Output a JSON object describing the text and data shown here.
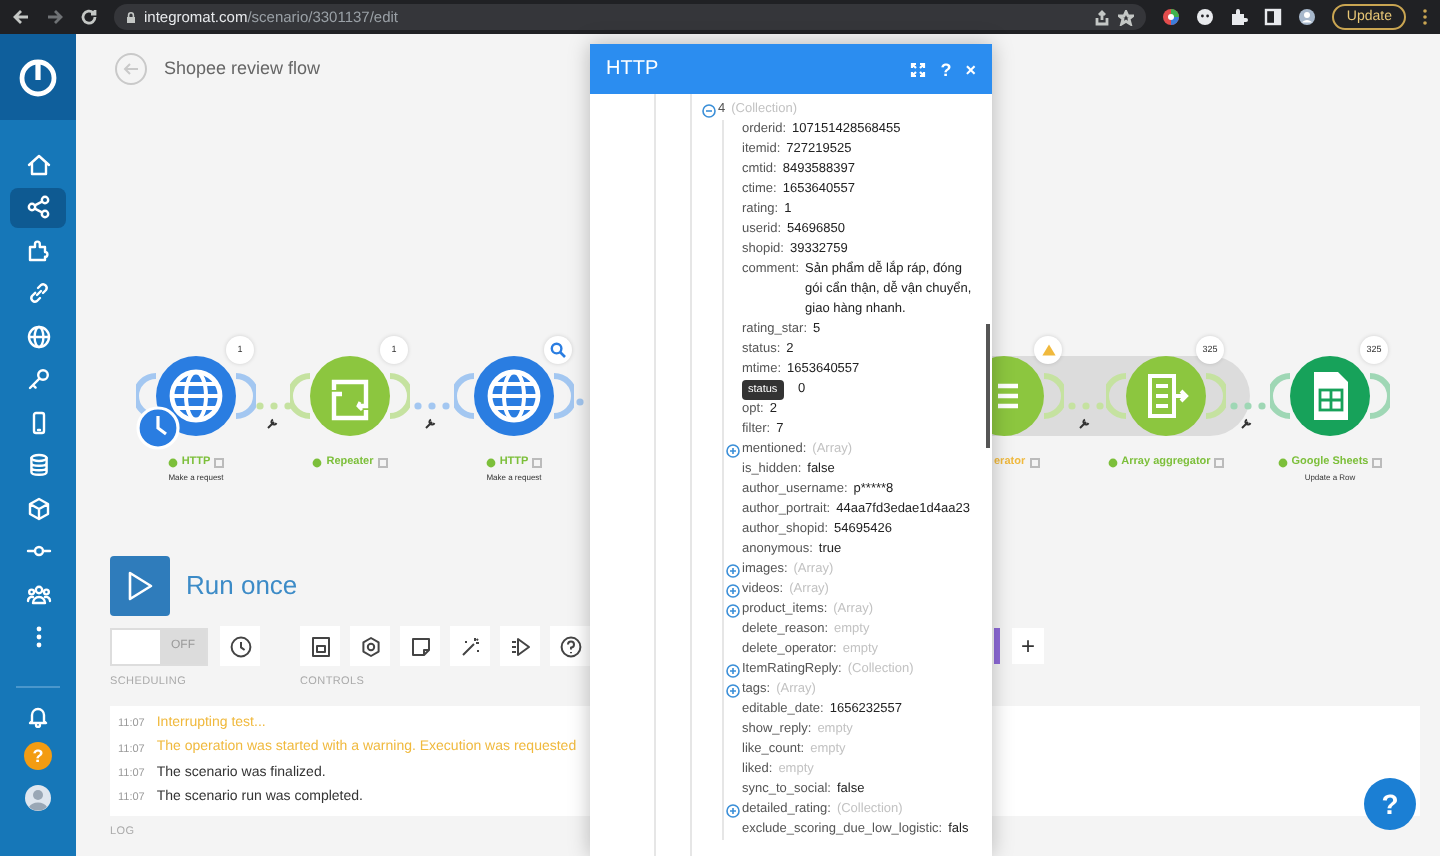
{
  "browser": {
    "url_host": "integromat.com",
    "url_path": "/scenario/3301137/edit",
    "update_label": "Update"
  },
  "sidebar": {
    "items": [
      {
        "selected": false
      },
      {
        "selected": true
      },
      {
        "selected": false
      },
      {
        "selected": false
      },
      {
        "selected": false
      },
      {
        "selected": false
      },
      {
        "selected": false
      },
      {
        "selected": false
      },
      {
        "selected": false
      },
      {
        "selected": false
      },
      {
        "selected": false
      },
      {
        "selected": false
      }
    ],
    "help_label": "?"
  },
  "scenario": {
    "title": "Shopee review flow"
  },
  "modules": [
    {
      "name": "HTTP",
      "subtitle": "Make a request",
      "count": "1",
      "kind": "http",
      "warning": false,
      "scheduled": true,
      "selected": false
    },
    {
      "name": "Repeater",
      "count": "1",
      "kind": "repeater",
      "warning": false,
      "scheduled": false,
      "selected": false
    },
    {
      "name": "HTTP",
      "subtitle": "Make a request",
      "kind": "http",
      "warning": false,
      "scheduled": false,
      "selected": true
    },
    {
      "name": "erator",
      "kind": "iterator",
      "warning": true,
      "scheduled": false,
      "selected": false
    },
    {
      "name": "Array aggregator",
      "count": "325",
      "kind": "aggregator",
      "warning": false,
      "scheduled": false,
      "selected": false
    },
    {
      "name": "Google Sheets",
      "subtitle": "Update a Row",
      "count": "325",
      "kind": "sheets",
      "warning": false,
      "scheduled": false,
      "selected": false
    }
  ],
  "run": {
    "label": "Run once"
  },
  "scheduling": {
    "label": "SCHEDULING",
    "toggle_label": "OFF",
    "on": false
  },
  "controls": {
    "label": "CONTROLS",
    "add_label": "+"
  },
  "log": {
    "label": "LOG",
    "entries": [
      {
        "time": "11:07",
        "text": "Interrupting test...",
        "warning": true
      },
      {
        "time": "11:07",
        "text": "The operation was started with a warning. Execution was requested",
        "warning": true
      },
      {
        "time": "11:07",
        "text": "The scenario was finalized.",
        "warning": false
      },
      {
        "time": "11:07",
        "text": "The scenario run was completed.",
        "warning": false
      }
    ]
  },
  "dialog": {
    "title": "HTTP",
    "help_label": "?",
    "close_label": "×",
    "tree": {
      "key": "4",
      "value": "(Collection)",
      "kind": "hint",
      "expanded": true,
      "children": [
        {
          "key": "orderid:",
          "value": "107151428568455",
          "kind": "value"
        },
        {
          "key": "itemid:",
          "value": "727219525",
          "kind": "value"
        },
        {
          "key": "cmtid:",
          "value": "8493588397",
          "kind": "value"
        },
        {
          "key": "ctime:",
          "value": "1653640557",
          "kind": "value"
        },
        {
          "key": "rating:",
          "value": "1",
          "kind": "value"
        },
        {
          "key": "userid:",
          "value": "54696850",
          "kind": "value"
        },
        {
          "key": "shopid:",
          "value": "39332759",
          "kind": "value"
        },
        {
          "key": "comment:",
          "value": "Sản phẩm dễ lắp ráp, đóng gói cẩn thận, dễ vận chuyển, giao hàng nhanh.",
          "kind": "value"
        },
        {
          "key": "rating_star:",
          "value": "5",
          "kind": "value"
        },
        {
          "key": "status:",
          "value": "2",
          "kind": "value"
        },
        {
          "key": "mtime:",
          "value": "1653640557",
          "kind": "value"
        },
        {
          "value": "0",
          "kind": "value",
          "tooltip": "status"
        },
        {
          "key": "opt:",
          "value": "2",
          "kind": "value"
        },
        {
          "key": "filter:",
          "value": "7",
          "kind": "value"
        },
        {
          "key": "mentioned:",
          "value": "(Array)",
          "kind": "hint",
          "expanded": false
        },
        {
          "key": "is_hidden:",
          "value": "false",
          "kind": "value"
        },
        {
          "key": "author_username:",
          "value": "p*****8",
          "kind": "value"
        },
        {
          "key": "author_portrait:",
          "value": "44aa7fd3edae1d4aa23",
          "kind": "value"
        },
        {
          "key": "author_shopid:",
          "value": "54695426",
          "kind": "value"
        },
        {
          "key": "anonymous:",
          "value": "true",
          "kind": "value"
        },
        {
          "key": "images:",
          "value": "(Array)",
          "kind": "hint",
          "expanded": false
        },
        {
          "key": "videos:",
          "value": "(Array)",
          "kind": "hint",
          "expanded": false
        },
        {
          "key": "product_items:",
          "value": "(Array)",
          "kind": "hint",
          "expanded": false
        },
        {
          "key": "delete_reason:",
          "value": "empty",
          "kind": "hint"
        },
        {
          "key": "delete_operator:",
          "value": "empty",
          "kind": "hint"
        },
        {
          "key": "ItemRatingReply:",
          "value": "(Collection)",
          "kind": "hint",
          "expanded": false
        },
        {
          "key": "tags:",
          "value": "(Array)",
          "kind": "hint",
          "expanded": false
        },
        {
          "key": "editable_date:",
          "value": "1656232557",
          "kind": "value"
        },
        {
          "key": "show_reply:",
          "value": "empty",
          "kind": "hint"
        },
        {
          "key": "like_count:",
          "value": "empty",
          "kind": "hint"
        },
        {
          "key": "liked:",
          "value": "empty",
          "kind": "hint"
        },
        {
          "key": "sync_to_social:",
          "value": "false",
          "kind": "value"
        },
        {
          "key": "detailed_rating:",
          "value": "(Collection)",
          "kind": "hint",
          "expanded": false
        },
        {
          "key": "exclude_scoring_due_low_logistic:",
          "value": "fals",
          "kind": "value"
        }
      ]
    }
  }
}
